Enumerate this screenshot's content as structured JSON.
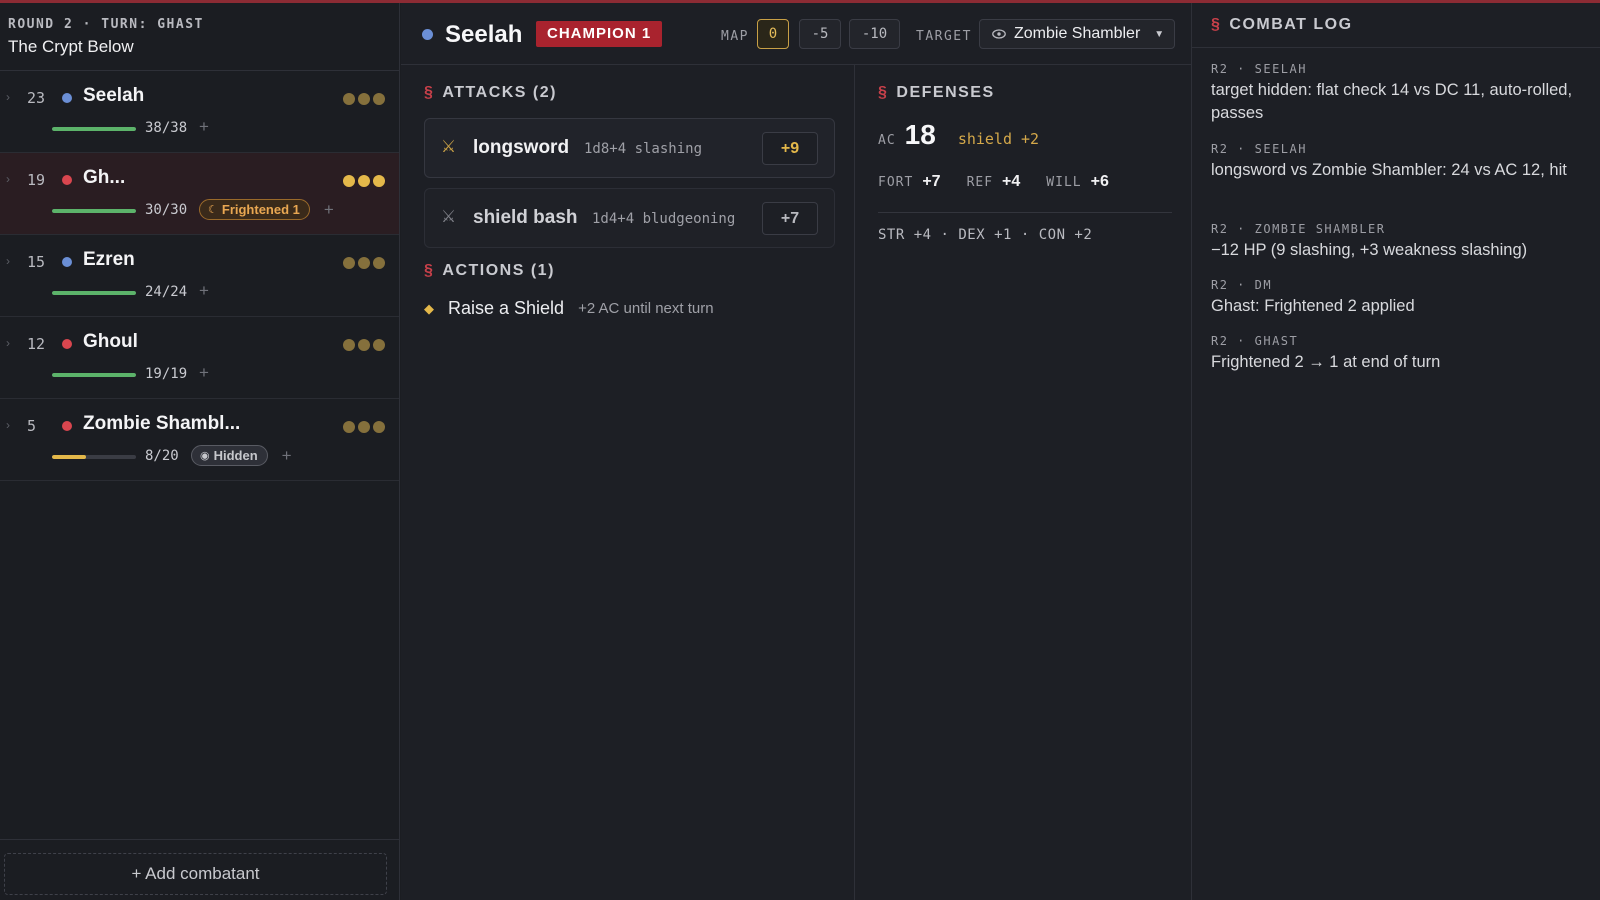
{
  "encounter": {
    "round_label": "ROUND 2 · TURN: GHAST",
    "title": "The Crypt Below",
    "add_combatant": "+ Add combatant"
  },
  "colors": {
    "party": "#6b8fd6",
    "enemy": "#d9464f",
    "hp_full": "#5cb36a",
    "hp_low": "#e4b84a",
    "accent": "#a9232e"
  },
  "combatants": [
    {
      "initiative": "23",
      "name": "Seelah",
      "side": "party",
      "hp": "38/38",
      "hp_fraction": 1.0,
      "actions_remaining": 0,
      "badges": []
    },
    {
      "initiative": "19",
      "name": "Gh...",
      "side": "enemy",
      "hp": "30/30",
      "hp_fraction": 1.0,
      "actions_remaining": 3,
      "active": true,
      "badges": [
        {
          "label": "Frightened 1",
          "icon": "frightened-icon",
          "kind": "frightened"
        }
      ]
    },
    {
      "initiative": "15",
      "name": "Ezren",
      "side": "party",
      "hp": "24/24",
      "hp_fraction": 1.0,
      "actions_remaining": 0,
      "badges": []
    },
    {
      "initiative": "12",
      "name": "Ghoul",
      "side": "enemy",
      "hp": "19/19",
      "hp_fraction": 1.0,
      "actions_remaining": 0,
      "badges": []
    },
    {
      "initiative": "5",
      "name": "Zombie Shambl...",
      "side": "enemy",
      "hp": "8/20",
      "hp_fraction": 0.4,
      "actions_remaining": 0,
      "badges": [
        {
          "label": "Hidden",
          "icon": "eye-icon",
          "kind": "hidden"
        }
      ]
    }
  ],
  "selected": {
    "name": "Seelah",
    "class_badge": "CHAMPION 1",
    "map_label": "MAP",
    "map_options": [
      "0",
      "-5",
      "-10"
    ],
    "map_selected": "0",
    "target_label": "TARGET",
    "target_value": "Zombie Shambler",
    "attacks_title": "ATTACKS (2)",
    "attacks": [
      {
        "name": "longsword",
        "damage": "1d8+4 slashing",
        "bonus": "+9"
      },
      {
        "name": "shield bash",
        "damage": "1d4+4 bludgeoning",
        "bonus": "+7"
      }
    ],
    "actions_title": "ACTIONS (1)",
    "actions": [
      {
        "name": "Raise a Shield",
        "desc": "+2 AC until next turn"
      }
    ],
    "defenses_title": "DEFENSES",
    "defenses": {
      "ac_label": "AC",
      "ac": "18",
      "shield": "shield +2",
      "fort_label": "FORT",
      "fort": "+7",
      "ref_label": "REF",
      "ref": "+4",
      "will_label": "WILL",
      "will": "+6",
      "abilities": "STR +4 · DEX +1 · CON +2"
    }
  },
  "combat_log": {
    "title": "COMBAT LOG",
    "entries": [
      {
        "meta": "R2 · SEELAH",
        "text": "target hidden: flat check 14 vs DC 11, auto-rolled, passes"
      },
      {
        "meta": "R2 · SEELAH",
        "text": "longsword vs Zombie Shambler: 24 vs AC 12, hit"
      },
      {
        "meta": "R2 · ZOMBIE SHAMBLER",
        "text": "−12 HP (9 slashing, +3 weakness slashing)"
      },
      {
        "meta": "R2 · DM",
        "text": "Ghast: Frightened 2 applied"
      },
      {
        "meta": "R2 · GHAST",
        "text": "Frightened 2 → 1 at end of turn"
      }
    ]
  }
}
